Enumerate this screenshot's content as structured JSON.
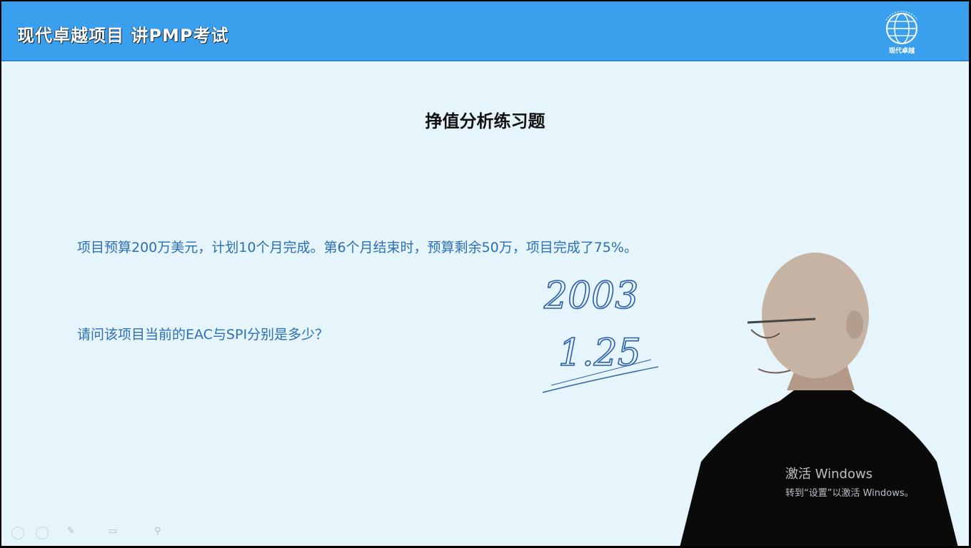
{
  "header": {
    "title": "现代卓越项目  讲PMP考试",
    "logo_text": "现代卓越"
  },
  "slide": {
    "title": "挣值分析练习题",
    "question_line1": "项目预算200万美元，计划10个月完成。第6个月结束时，预算剩余50万，项目完成了75%。",
    "question_line2": "请问该项目当前的EAC与SPI分别是多少？"
  },
  "handwriting": {
    "line1": "2003",
    "line2": "1.25"
  },
  "watermark": {
    "line1": "激活 Windows",
    "line2": "转到“设置”以激活 Windows。"
  },
  "colors": {
    "header": "#3aa0ee",
    "background": "#e6f4fb",
    "body_text": "#2b6fb6"
  }
}
